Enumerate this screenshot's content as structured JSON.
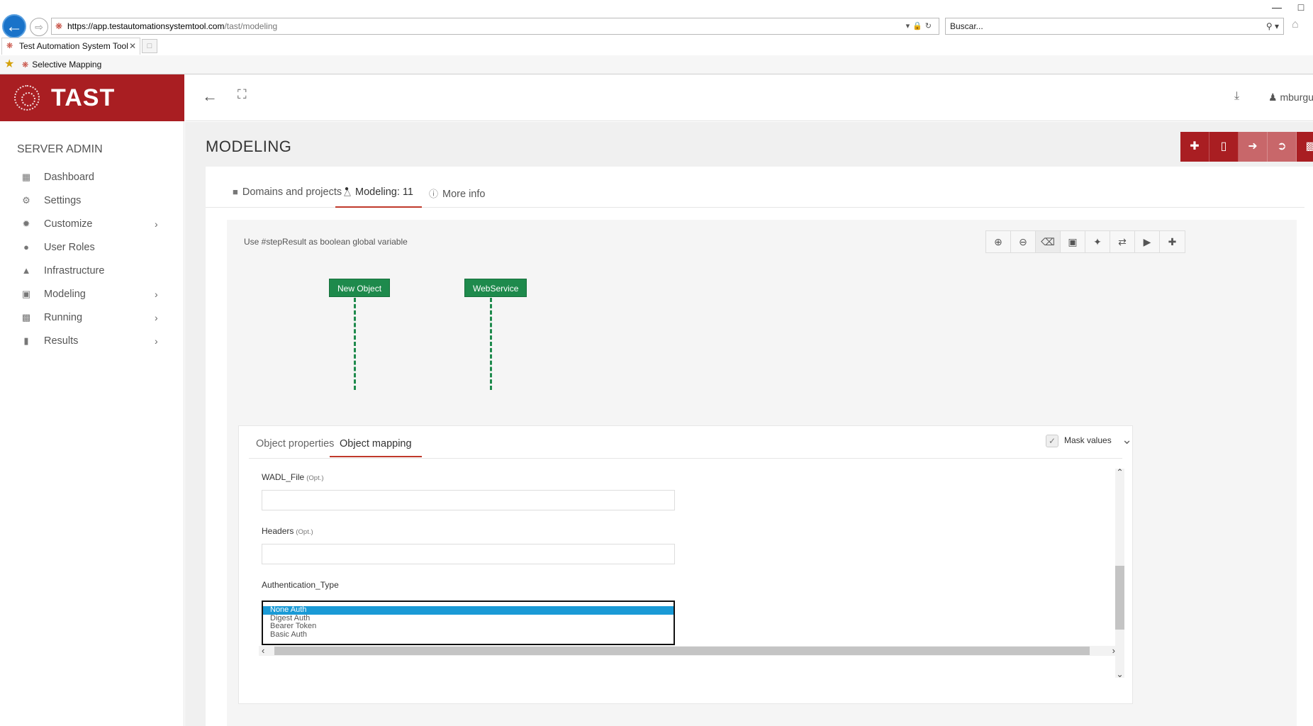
{
  "browser": {
    "url_host": "https://app.testautomationsystemtool.com",
    "url_path": "/tast/modeling",
    "search_placeholder": "Buscar...",
    "tab_title": "Test Automation System Tool",
    "favorite_label": "Selective Mapping",
    "icons": [
      "back-arrow-icon",
      "forward-arrow-icon",
      "lock-icon",
      "refresh-icon",
      "search-icon",
      "home-icon",
      "star-icon"
    ]
  },
  "app": {
    "brand": "TAST",
    "user": "mburgu",
    "accent_color": "#a91e22",
    "sidebar": {
      "title": "SERVER ADMIN",
      "items": [
        {
          "label": "Dashboard",
          "icon": "dashboard-icon",
          "has_submenu": false
        },
        {
          "label": "Settings",
          "icon": "gear-icon",
          "has_submenu": false
        },
        {
          "label": "Customize",
          "icon": "cog-icon",
          "has_submenu": true
        },
        {
          "label": "User Roles",
          "icon": "users-icon",
          "has_submenu": false
        },
        {
          "label": "Infrastructure",
          "icon": "road-icon",
          "has_submenu": false
        },
        {
          "label": "Modeling",
          "icon": "briefcase-icon",
          "has_submenu": true
        },
        {
          "label": "Running",
          "icon": "calendar-icon",
          "has_submenu": true
        },
        {
          "label": "Results",
          "icon": "bar-chart-icon",
          "has_submenu": true
        }
      ]
    }
  },
  "page": {
    "title": "MODELING",
    "action_buttons": [
      "plus-icon",
      "excel-file-icon",
      "sign-in-icon",
      "sign-out-icon",
      "save-icon"
    ],
    "tabs": [
      {
        "label": "Domains and projects",
        "icon": "folder-icon"
      },
      {
        "label": "Modeling: 11",
        "icon": "flask-icon"
      },
      {
        "label": "More info",
        "icon": "info-icon"
      }
    ],
    "canvas": {
      "hint": "Use #stepResult as boolean global variable",
      "tools": [
        "zoom-in-icon",
        "zoom-out-icon",
        "trash-icon",
        "image-icon",
        "magic-wand-icon",
        "shuffle-icon",
        "play-icon",
        "plus-icon"
      ],
      "nodes": [
        "New Object",
        "WebService"
      ],
      "node_color": "#1e8a4c"
    },
    "panel": {
      "tabs": [
        "Object properties",
        "Object mapping"
      ],
      "mask_label": "Mask values",
      "optional_marker": "(Opt.)",
      "fields": [
        {
          "label": "WADL_File",
          "optional": true,
          "value": ""
        },
        {
          "label": "Headers",
          "optional": true,
          "value": ""
        },
        {
          "label": "Authentication_Type",
          "optional": false
        }
      ],
      "auth_options": [
        "None Auth",
        "Digest Auth",
        "Bearer Token",
        "Basic Auth"
      ],
      "auth_selected": "None Auth"
    }
  }
}
